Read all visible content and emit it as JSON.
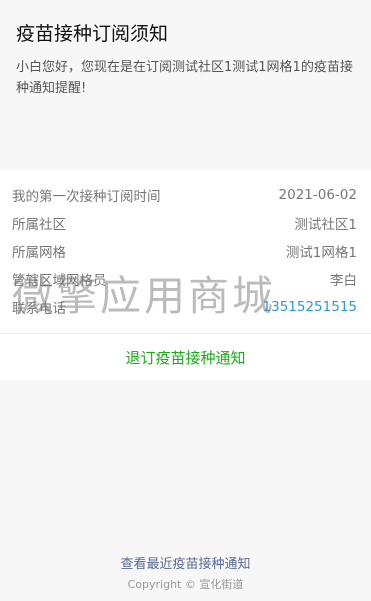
{
  "header": {
    "title": "疫苗接种订阅须知",
    "description": "小白您好，您现在是在订阅测试社区1测试1网格1的疫苗接种通知提醒!"
  },
  "info_rows": [
    {
      "label": "我的第一次接种订阅时间",
      "value": "2021-06-02"
    },
    {
      "label": "所属社区",
      "value": "测试社区1"
    },
    {
      "label": "所属网格",
      "value": "测试1网格1"
    },
    {
      "label": "管辖区域网格员",
      "value": "李白"
    },
    {
      "label": "联系电话",
      "value": "13515251515"
    }
  ],
  "action": {
    "unsubscribe_label": "退订疫苗接种通知"
  },
  "watermark": {
    "text": "微擎应用商城"
  },
  "footer": {
    "link_label": "查看最近疫苗接种通知",
    "copyright": "Copyright © 宣化街道"
  },
  "colors": {
    "accent": "#1aad19",
    "link": "#2c9ad6",
    "footer_link": "#576b95"
  }
}
